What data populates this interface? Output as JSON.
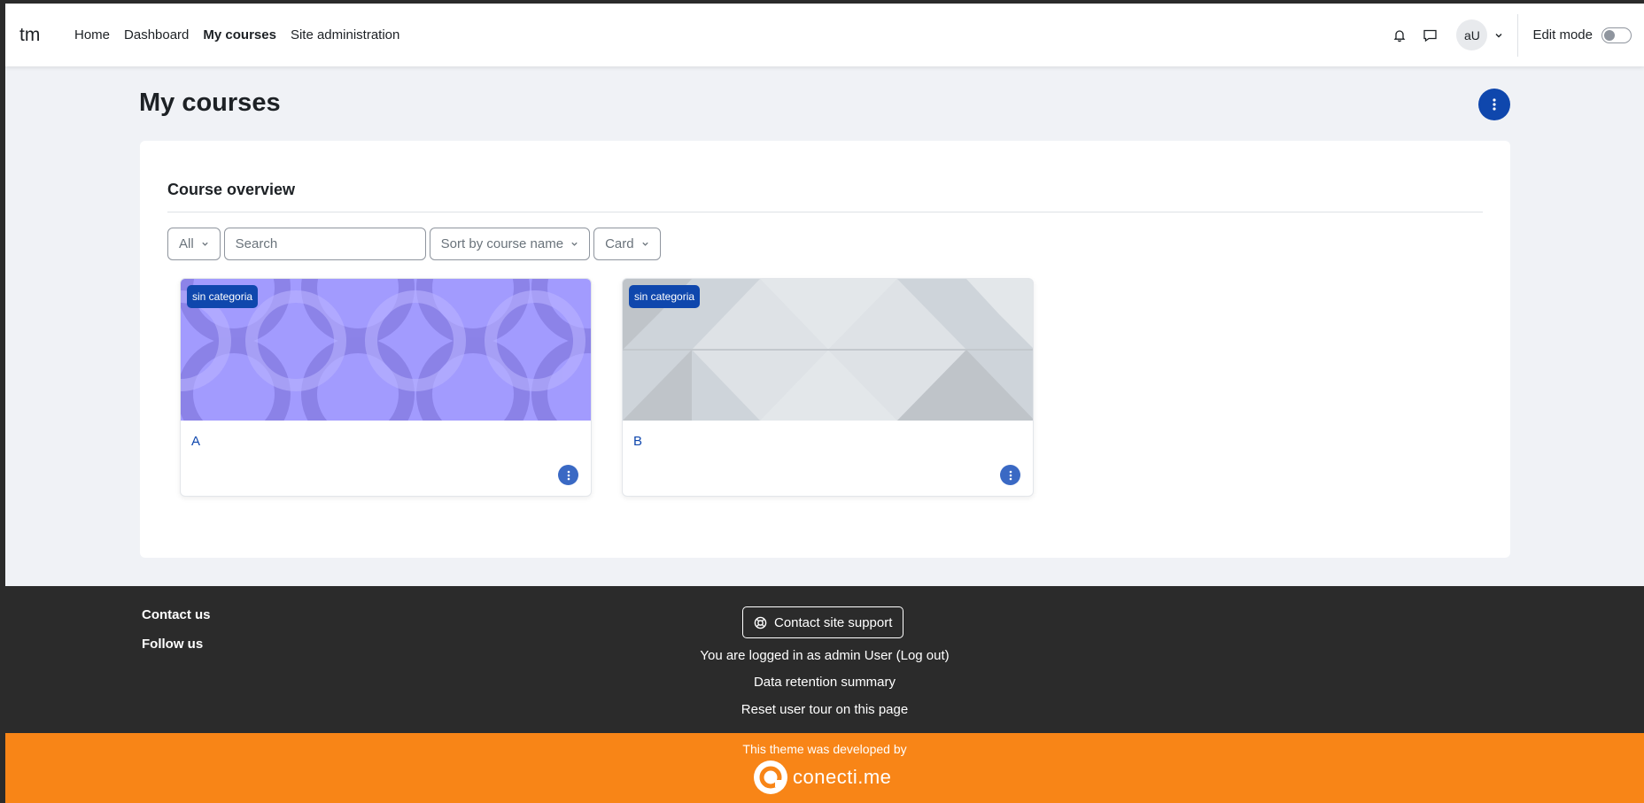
{
  "navbar": {
    "brand": "tm",
    "links": [
      {
        "label": "Home",
        "active": false
      },
      {
        "label": "Dashboard",
        "active": false
      },
      {
        "label": "My courses",
        "active": true
      },
      {
        "label": "Site administration",
        "active": false
      }
    ],
    "user_initials": "aU",
    "edit_mode_label": "Edit mode",
    "edit_mode_on": false
  },
  "page": {
    "title": "My courses"
  },
  "course_overview": {
    "title": "Course overview",
    "filter": {
      "selected": "All"
    },
    "search": {
      "placeholder": "Search",
      "value": ""
    },
    "sort": {
      "selected": "Sort by course name"
    },
    "view": {
      "selected": "Card"
    },
    "courses": [
      {
        "category": "sin categoria",
        "name": "A",
        "image_pattern": "circles",
        "color": "#a29bfe"
      },
      {
        "category": "sin categoria",
        "name": "B",
        "image_pattern": "triangles",
        "color": "#ced4da"
      }
    ]
  },
  "footer": {
    "contact_us": "Contact us",
    "follow_us": "Follow us",
    "support_button": "Contact site support",
    "logged_in_prefix": "You are logged in as ",
    "logged_in_user": "admin User",
    "logout_label": "Log out",
    "data_retention": "Data retention summary",
    "reset_tour": "Reset user tour on this page"
  },
  "brand_strip": {
    "developed_by": "This theme was developed by",
    "logo_text": "conecti.me",
    "color": "#f88517"
  },
  "colors": {
    "accent": "#0f47ad",
    "footer_bg": "#2b2b2b",
    "page_bg": "#f0f2f6"
  }
}
